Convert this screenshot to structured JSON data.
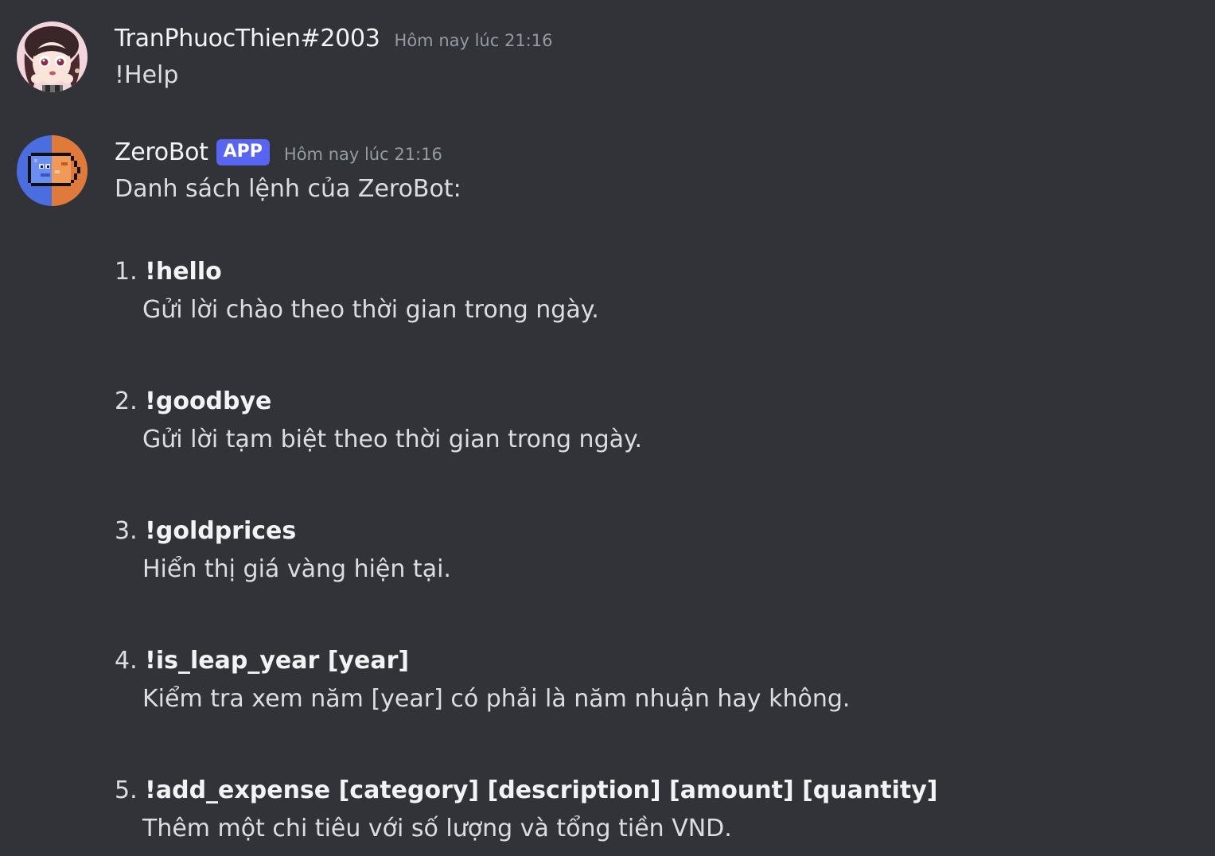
{
  "messages": [
    {
      "username": "TranPhuocThien#2003",
      "timestamp": "Hôm nay lúc 21:16",
      "content": "!Help"
    },
    {
      "username": "ZeroBot",
      "badge": "APP",
      "timestamp": "Hôm nay lúc 21:16",
      "content": "Danh sách lệnh của ZeroBot:",
      "commands": [
        {
          "num": "1.",
          "name": "!hello",
          "desc": "Gửi lời chào theo thời gian trong ngày."
        },
        {
          "num": "2.",
          "name": "!goodbye",
          "desc": "Gửi lời tạm biệt theo thời gian trong ngày."
        },
        {
          "num": "3.",
          "name": "!goldprices",
          "desc": "Hiển thị giá vàng hiện tại."
        },
        {
          "num": "4.",
          "name": "!is_leap_year [year]",
          "desc": "Kiểm tra xem năm [year] có phải là năm nhuận hay không."
        },
        {
          "num": "5.",
          "name": "!add_expense [category] [description] [amount] [quantity]",
          "desc": "Thêm một chi tiêu với số lượng và tổng tiền VND."
        }
      ]
    }
  ],
  "colors": {
    "background": "#313338",
    "badge": "#5865f2",
    "timestamp": "#949ba4",
    "text": "#dbdee1"
  }
}
